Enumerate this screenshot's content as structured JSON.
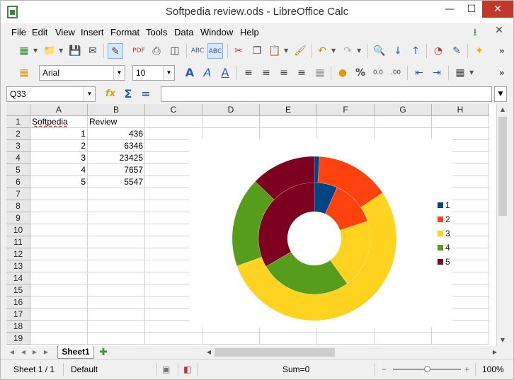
{
  "window": {
    "title": "Softpedia review.ods - LibreOffice Calc"
  },
  "menubar": {
    "items": [
      "File",
      "Edit",
      "View",
      "Insert",
      "Format",
      "Tools",
      "Data",
      "Window",
      "Help"
    ]
  },
  "format_toolbar": {
    "font_name": "Arial",
    "font_size": "10"
  },
  "formula_bar": {
    "cell_ref": "Q33",
    "content": ""
  },
  "columns": [
    "A",
    "B",
    "C",
    "D",
    "E",
    "F",
    "G",
    "H"
  ],
  "rows": [
    "1",
    "2",
    "3",
    "4",
    "5",
    "6",
    "7",
    "8",
    "9",
    "10",
    "11",
    "12",
    "13",
    "14",
    "15",
    "16",
    "17",
    "18",
    "19"
  ],
  "cells": {
    "A1": "Softpedia",
    "B1": "Review",
    "A2": "1",
    "B2": "436",
    "A3": "2",
    "B3": "6346",
    "A4": "3",
    "B4": "23425",
    "A5": "4",
    "B5": "7657",
    "A6": "5",
    "B6": "5547"
  },
  "chart_data": {
    "type": "pie",
    "style": "donut",
    "rings": [
      {
        "name": "Softpedia",
        "values": [
          1,
          2,
          3,
          4,
          5
        ]
      },
      {
        "name": "Review",
        "values": [
          436,
          6346,
          23425,
          7657,
          5547
        ]
      }
    ],
    "categories": [
      "1",
      "2",
      "3",
      "4",
      "5"
    ],
    "colors": [
      "#004586",
      "#ff420e",
      "#ffd320",
      "#579d1c",
      "#7e0021"
    ],
    "legend": [
      "1",
      "2",
      "3",
      "4",
      "5"
    ],
    "legend_position": "right"
  },
  "sheet_tabs": {
    "active": "Sheet1"
  },
  "statusbar": {
    "sheet": "Sheet 1 / 1",
    "page_style": "Default",
    "sum": "Sum=0",
    "zoom": "100%",
    "zoom_fraction": 0.5
  }
}
